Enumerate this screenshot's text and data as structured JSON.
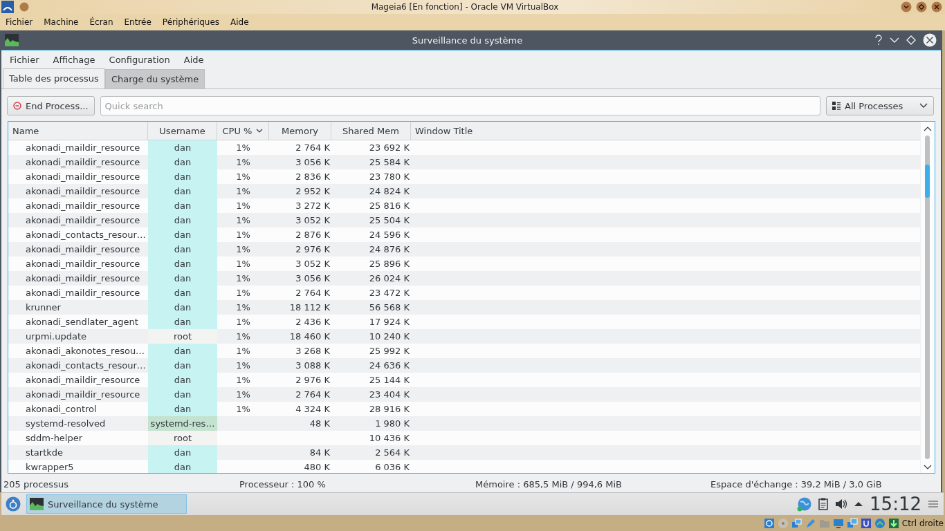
{
  "host": {
    "title": "Mageia6 [En fonction] - Oracle VM VirtualBox",
    "menu": [
      "Fichier",
      "Machine",
      "Écran",
      "Entrée",
      "Périphériques",
      "Aide"
    ],
    "host_key": "Ctrl droite"
  },
  "window": {
    "title": "Surveillance du système",
    "menu": [
      "Fichier",
      "Affichage",
      "Configuration",
      "Aide"
    ],
    "tabs": [
      {
        "label": "Table des processus",
        "selected": true
      },
      {
        "label": "Charge du système",
        "selected": false
      }
    ],
    "end_button": "End Process...",
    "search": {
      "placeholder": "Quick search"
    },
    "filter": "All Processes",
    "columns": [
      {
        "label": "Name",
        "sorted": false
      },
      {
        "label": "Username",
        "sorted": false
      },
      {
        "label": "CPU %",
        "sorted": true
      },
      {
        "label": "Memory",
        "sorted": false
      },
      {
        "label": "Shared Mem",
        "sorted": false
      },
      {
        "label": "Window Title",
        "sorted": false
      }
    ],
    "rows": [
      {
        "name": "akonadi_maildir_resource",
        "user": "dan",
        "color": "#c8f3f3",
        "cpu": "1%",
        "memory": "2 764 K",
        "shared": "23 692 K"
      },
      {
        "name": "akonadi_maildir_resource",
        "user": "dan",
        "color": "#c8f3f3",
        "cpu": "1%",
        "memory": "3 056 K",
        "shared": "25 584 K"
      },
      {
        "name": "akonadi_maildir_resource",
        "user": "dan",
        "color": "#c8f3f3",
        "cpu": "1%",
        "memory": "2 836 K",
        "shared": "23 780 K"
      },
      {
        "name": "akonadi_maildir_resource",
        "user": "dan",
        "color": "#c8f3f3",
        "cpu": "1%",
        "memory": "2 952 K",
        "shared": "24 824 K"
      },
      {
        "name": "akonadi_maildir_resource",
        "user": "dan",
        "color": "#c8f3f3",
        "cpu": "1%",
        "memory": "3 272 K",
        "shared": "25 816 K"
      },
      {
        "name": "akonadi_maildir_resource",
        "user": "dan",
        "color": "#c8f3f3",
        "cpu": "1%",
        "memory": "3 052 K",
        "shared": "25 504 K"
      },
      {
        "name": "akonadi_contacts_resour…",
        "user": "dan",
        "color": "#c8f3f3",
        "cpu": "1%",
        "memory": "2 876 K",
        "shared": "24 596 K"
      },
      {
        "name": "akonadi_maildir_resource",
        "user": "dan",
        "color": "#c8f3f3",
        "cpu": "1%",
        "memory": "2 976 K",
        "shared": "24 876 K"
      },
      {
        "name": "akonadi_maildir_resource",
        "user": "dan",
        "color": "#c8f3f3",
        "cpu": "1%",
        "memory": "3 052 K",
        "shared": "25 896 K"
      },
      {
        "name": "akonadi_maildir_resource",
        "user": "dan",
        "color": "#c8f3f3",
        "cpu": "1%",
        "memory": "3 056 K",
        "shared": "26 024 K"
      },
      {
        "name": "akonadi_maildir_resource",
        "user": "dan",
        "color": "#c8f3f3",
        "cpu": "1%",
        "memory": "2 764 K",
        "shared": "23 472 K"
      },
      {
        "name": "krunner",
        "user": "dan",
        "color": "#c8f3f3",
        "cpu": "1%",
        "memory": "18 112 K",
        "shared": "56 568 K"
      },
      {
        "name": "akonadi_sendlater_agent",
        "user": "dan",
        "color": "#c8f3f3",
        "cpu": "1%",
        "memory": "2 436 K",
        "shared": "17 924 K"
      },
      {
        "name": "urpmi.update",
        "user": "root",
        "color": "#f3f3f1",
        "cpu": "1%",
        "memory": "18 460 K",
        "shared": "10 240 K"
      },
      {
        "name": "akonadi_akonotes_resou…",
        "user": "dan",
        "color": "#c8f3f3",
        "cpu": "1%",
        "memory": "3 268 K",
        "shared": "25 992 K"
      },
      {
        "name": "akonadi_contacts_resour…",
        "user": "dan",
        "color": "#c8f3f3",
        "cpu": "1%",
        "memory": "3 088 K",
        "shared": "24 636 K"
      },
      {
        "name": "akonadi_maildir_resource",
        "user": "dan",
        "color": "#c8f3f3",
        "cpu": "1%",
        "memory": "2 976 K",
        "shared": "25 144 K"
      },
      {
        "name": "akonadi_maildir_resource",
        "user": "dan",
        "color": "#c8f3f3",
        "cpu": "1%",
        "memory": "2 764 K",
        "shared": "23 404 K"
      },
      {
        "name": "akonadi_control",
        "user": "dan",
        "color": "#c8f3f3",
        "cpu": "1%",
        "memory": "4 324 K",
        "shared": "28 916 K"
      },
      {
        "name": "systemd-resolved",
        "user": "systemd-res…",
        "color": "#c3e2cf",
        "memory": "48 K",
        "shared": "1 980 K"
      },
      {
        "name": "sddm-helper",
        "user": "root",
        "color": "#f3f3f1",
        "shared": "10 436 K"
      },
      {
        "name": "startkde",
        "user": "dan",
        "color": "#c8f3f3",
        "memory": "84 K",
        "shared": "2 564 K"
      },
      {
        "name": "kwrapper5",
        "user": "dan",
        "color": "#c8f3f3",
        "memory": "480 K",
        "shared": "6 036 K"
      }
    ],
    "status": [
      "205 processus",
      "Processeur : 100 %",
      "Mémoire : 685,5 MiB / 994,6 MiB",
      "Espace d'échange : 39,2 MiB / 3,0 GiB"
    ]
  },
  "taskbar": {
    "task": "Surveillance du système",
    "clock": "15:12"
  }
}
